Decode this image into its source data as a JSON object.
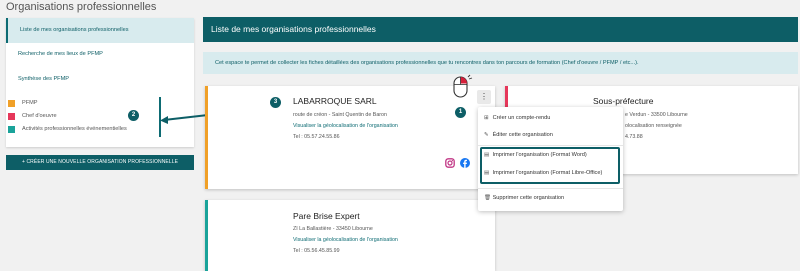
{
  "page": {
    "title": "Organisations professionnelles"
  },
  "sidebar": {
    "items": [
      {
        "label": "Liste de mes organisations professionnelles"
      },
      {
        "label": "Recherche de mes lieux de PFMP"
      },
      {
        "label": "Synthèse des PFMP"
      }
    ],
    "legend": [
      {
        "label": "PFMP",
        "color": "#f0a028"
      },
      {
        "label": "Chef d'oeuvre",
        "color": "#e6375a"
      },
      {
        "label": "Activités professionnelles événementielles",
        "color": "#1aa39a"
      }
    ],
    "create_button": "+ CRÉER UNE NOUVELLE ORGANISATION PROFESSIONNELLE"
  },
  "main": {
    "header": "Liste de mes organisations professionnelles",
    "info": "Cet espace te permet de collecter les fiches détaillées des organisations professionnelles que tu rencontres dans ton parcours de formation (Chef d'oeuvre / PFMP / etc...)."
  },
  "cards": {
    "c1": {
      "name": "LABARROQUE SARL",
      "address": "route de créon - Saint Quentin de Baron",
      "link": "Visualiser la géolocalisation de l'organisation",
      "phone": "Tel : 05.57.24.55.86"
    },
    "c2": {
      "name": "Sous-préfecture",
      "address": "e Verdun - 33500 Libourne",
      "geo": "olocalisation renseignée",
      "phone": "4.73.88"
    },
    "c3": {
      "name": "Pare Brise Expert",
      "address": "ZI La Ballastière - 33450 Libourne",
      "link": "Visualiser la géolocalisation de l'organisation",
      "phone": "Tel : 05.56.45.85.99"
    }
  },
  "menu": {
    "items": [
      {
        "label": "Créer un compte-rendu",
        "icon": "file-plus-icon"
      },
      {
        "label": "Éditer cette organisation",
        "icon": "pencil-icon"
      },
      {
        "label": "Imprimer l'organisation (Format Word)",
        "icon": "document-icon"
      },
      {
        "label": "Imprimer l'organisation (Format Libre-Office)",
        "icon": "document-icon"
      },
      {
        "label": "Supprimer cette organisation",
        "icon": "trash-icon"
      }
    ]
  },
  "badges": {
    "one": "1",
    "two": "2",
    "three": "3"
  },
  "colors": {
    "primary": "#0d5e66",
    "light": "#d8ebee"
  }
}
